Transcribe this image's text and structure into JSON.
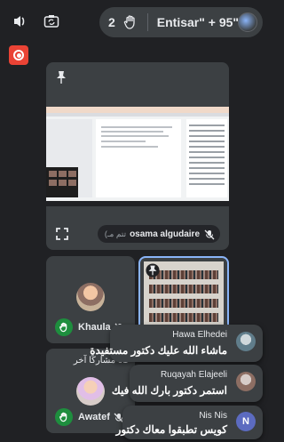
{
  "topbar": {
    "raised_hands_count": "2",
    "participants_label": "Entisar\" + 95\""
  },
  "main_tile": {
    "presenter_name": "osama algudaire",
    "presenting_suffix": "(تتم مـ"
  },
  "tiles": [
    {
      "name": "Khaula"
    },
    {
      "name": "Awatef",
      "status_text": "91 مشاركًا آخر"
    }
  ],
  "chats": [
    {
      "sender": "Hawa Elhedei",
      "message": "ماشاء الله عليك دكتور مستفيدة"
    },
    {
      "sender": "Ruqayah Elajeeli",
      "message": "استمر دكتور بارك الله فيك"
    },
    {
      "sender": "Nis Nis",
      "initial": "N",
      "message": "كويس تطبقوا معاك دكتور"
    }
  ],
  "colors": {
    "background": "#202124",
    "tile": "#3c4043",
    "record": "#ea4335",
    "hand_badge": "#1e8e3e",
    "active_border": "#8ab4f8"
  },
  "icons": [
    "audio-output-icon",
    "camera-switch-icon",
    "raised-hand-icon",
    "record-icon",
    "pin-icon",
    "expand-icon",
    "mic-off-icon"
  ]
}
